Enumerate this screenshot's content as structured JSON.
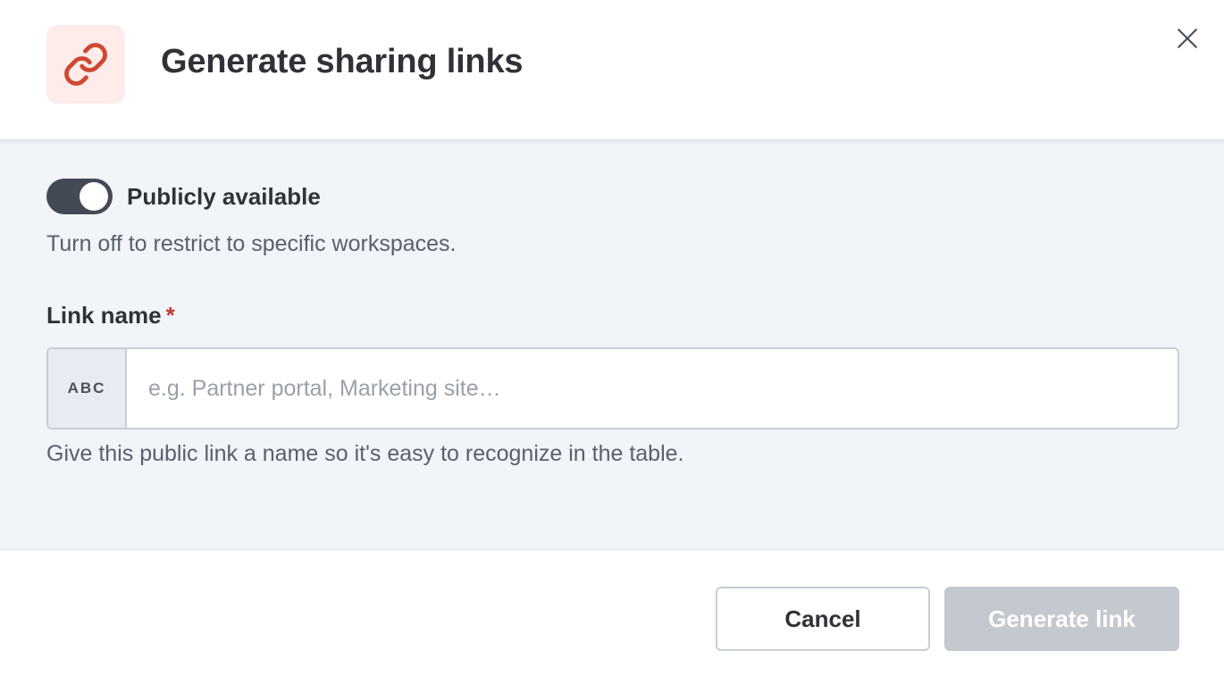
{
  "dialog": {
    "title": "Generate sharing links",
    "header_icon": "link-icon",
    "close_icon": "close-icon",
    "colors": {
      "accent_icon": "#d0472f",
      "icon_bg": "#fdecea",
      "toggle_on": "#434a56",
      "disabled_button": "#c4c8cf",
      "required": "#c0392b"
    }
  },
  "public_toggle": {
    "label": "Publicly available",
    "checked": true,
    "help": "Turn off to restrict to specific workspaces."
  },
  "link_name_field": {
    "label": "Link name",
    "required_mark": "*",
    "prefix": "ABC",
    "value": "",
    "placeholder": "e.g. Partner portal, Marketing site…",
    "help": "Give this public link a name so it's easy to recognize in the table."
  },
  "footer": {
    "cancel_label": "Cancel",
    "generate_label": "Generate link",
    "generate_disabled": true
  }
}
